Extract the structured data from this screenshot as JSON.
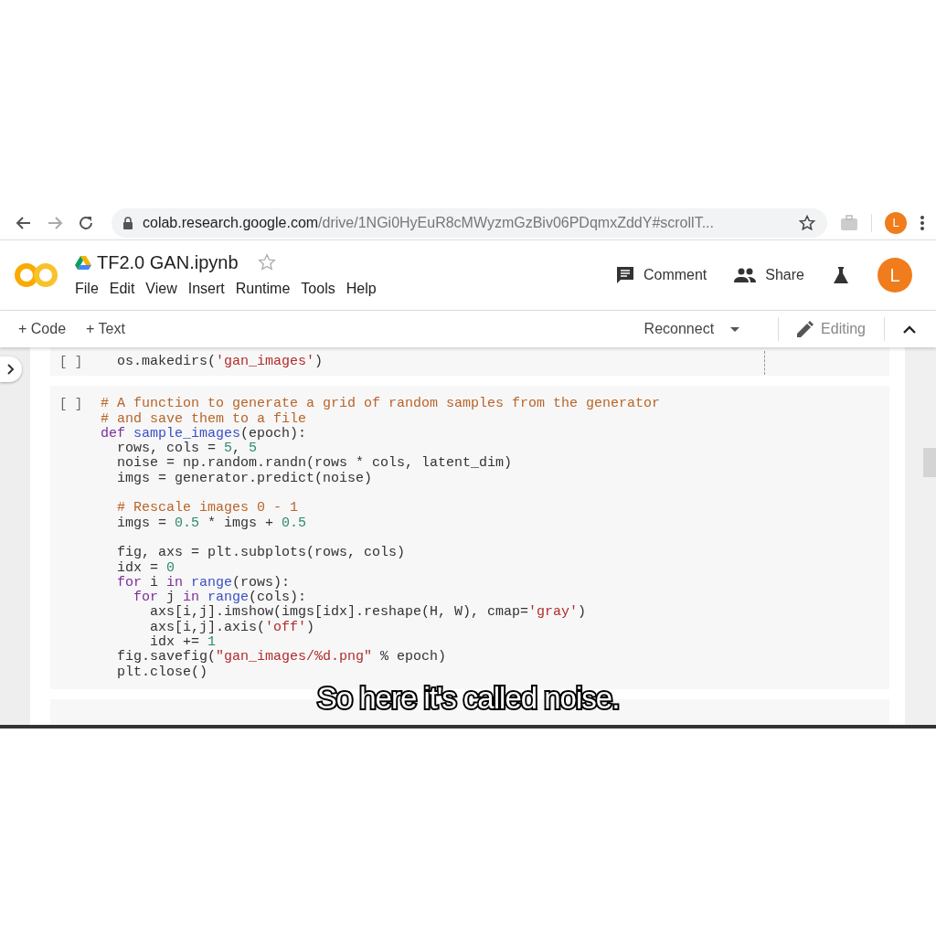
{
  "browser": {
    "url_host": "colab.research.google.com",
    "url_path": "/drive/1NGi0HyEuR8cMWyzmGzBiv06PDqmxZddY#scrollT...",
    "avatar_letter": "L"
  },
  "notebook": {
    "title": "TF2.0 GAN.ipynb",
    "menu": [
      "File",
      "Edit",
      "View",
      "Insert",
      "Runtime",
      "Tools",
      "Help"
    ],
    "comment": "Comment",
    "share": "Share",
    "avatar_letter": "L"
  },
  "toolbar": {
    "add_code": "+ Code",
    "add_text": "+ Text",
    "runtime": "Reconnect",
    "mode": "Editing"
  },
  "cells": [
    {
      "run_label": "[ ]",
      "lines": [
        {
          "kind": "code",
          "tokens": [
            {
              "text": "  os.makedirs(",
              "kind": "plain"
            },
            {
              "text": "'gan_images'",
              "kind": "string"
            },
            {
              "text": ")",
              "kind": "plain"
            }
          ]
        }
      ]
    },
    {
      "run_label": "[ ]",
      "lines": [
        {
          "kind": "code",
          "tokens": [
            {
              "text": "# A function to generate a grid of random samples from the generator",
              "kind": "comment"
            }
          ]
        },
        {
          "kind": "code",
          "tokens": [
            {
              "text": "# and save them to a file",
              "kind": "comment"
            }
          ]
        },
        {
          "kind": "code",
          "tokens": [
            {
              "text": "def ",
              "kind": "keyword"
            },
            {
              "text": "sample_images",
              "kind": "function"
            },
            {
              "text": "(epoch):",
              "kind": "plain"
            }
          ]
        },
        {
          "kind": "code",
          "tokens": [
            {
              "text": "  rows, cols = ",
              "kind": "plain"
            },
            {
              "text": "5",
              "kind": "number"
            },
            {
              "text": ", ",
              "kind": "plain"
            },
            {
              "text": "5",
              "kind": "number"
            }
          ]
        },
        {
          "kind": "code",
          "tokens": [
            {
              "text": "  noise = np.random.randn(rows * cols, latent_dim)",
              "kind": "plain"
            }
          ]
        },
        {
          "kind": "code",
          "tokens": [
            {
              "text": "  imgs = generator.predict(noise)",
              "kind": "plain"
            }
          ]
        },
        {
          "kind": "blank"
        },
        {
          "kind": "code",
          "tokens": [
            {
              "text": "  # Rescale images 0 - 1",
              "kind": "comment"
            }
          ]
        },
        {
          "kind": "code",
          "tokens": [
            {
              "text": "  imgs = ",
              "kind": "plain"
            },
            {
              "text": "0.5",
              "kind": "number"
            },
            {
              "text": " * imgs + ",
              "kind": "plain"
            },
            {
              "text": "0.5",
              "kind": "number"
            }
          ]
        },
        {
          "kind": "blank"
        },
        {
          "kind": "code",
          "tokens": [
            {
              "text": "  fig, axs = plt.subplots(rows, cols)",
              "kind": "plain"
            }
          ]
        },
        {
          "kind": "code",
          "tokens": [
            {
              "text": "  idx = ",
              "kind": "plain"
            },
            {
              "text": "0",
              "kind": "number"
            }
          ]
        },
        {
          "kind": "code",
          "tokens": [
            {
              "text": "  for",
              "kind": "keyword"
            },
            {
              "text": " i ",
              "kind": "plain"
            },
            {
              "text": "in ",
              "kind": "keyword"
            },
            {
              "text": "range",
              "kind": "function"
            },
            {
              "text": "(rows):",
              "kind": "plain"
            }
          ]
        },
        {
          "kind": "code",
          "tokens": [
            {
              "text": "    for",
              "kind": "keyword"
            },
            {
              "text": " j ",
              "kind": "plain"
            },
            {
              "text": "in ",
              "kind": "keyword"
            },
            {
              "text": "range",
              "kind": "function"
            },
            {
              "text": "(cols):",
              "kind": "plain"
            }
          ]
        },
        {
          "kind": "code",
          "tokens": [
            {
              "text": "      axs[i,j].imshow(imgs[idx].reshape(H, W), cmap=",
              "kind": "plain"
            },
            {
              "text": "'gray'",
              "kind": "string"
            },
            {
              "text": ")",
              "kind": "plain"
            }
          ]
        },
        {
          "kind": "code",
          "tokens": [
            {
              "text": "      axs[i,j].axis(",
              "kind": "plain"
            },
            {
              "text": "'off'",
              "kind": "string"
            },
            {
              "text": ")",
              "kind": "plain"
            }
          ]
        },
        {
          "kind": "code",
          "tokens": [
            {
              "text": "      idx += ",
              "kind": "plain"
            },
            {
              "text": "1",
              "kind": "number"
            }
          ]
        },
        {
          "kind": "code",
          "tokens": [
            {
              "text": "  fig.savefig(",
              "kind": "plain"
            },
            {
              "text": "\"gan_images/%d.png\"",
              "kind": "string"
            },
            {
              "text": " % epoch)",
              "kind": "plain"
            }
          ]
        },
        {
          "kind": "code",
          "tokens": [
            {
              "text": "  plt.close()",
              "kind": "plain"
            }
          ]
        }
      ]
    }
  ],
  "subtitle": "So here it's called noise."
}
